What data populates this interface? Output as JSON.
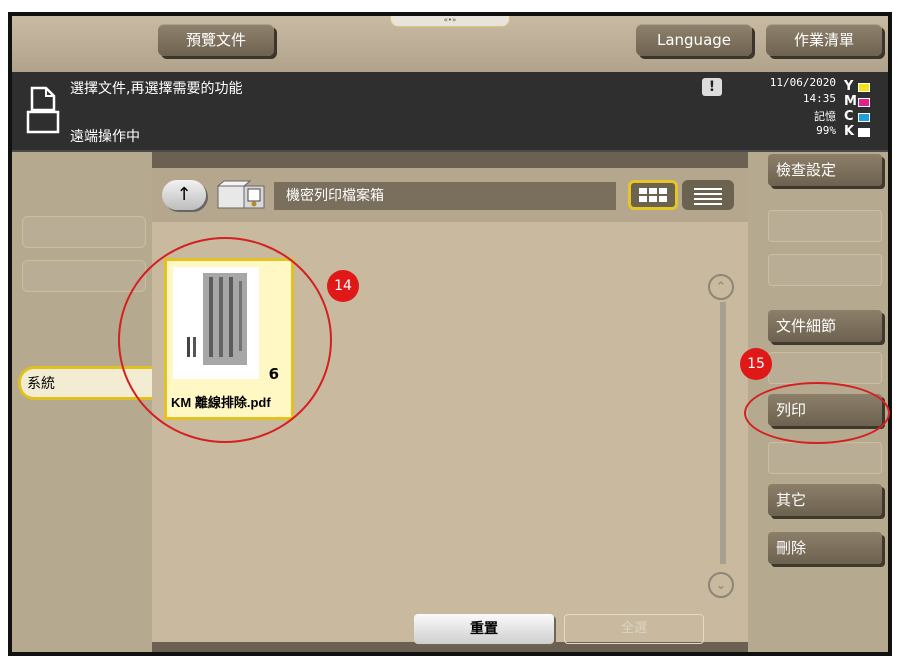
{
  "header": {
    "preview_tab": "預覽文件",
    "language_tab": "Language",
    "joblist_tab": "作業清單"
  },
  "status": {
    "message_line1": "選擇文件,再選擇需要的功能",
    "message_line2": "遠端操作中",
    "warning_symbol": "!",
    "date": "11/06/2020",
    "time": "14:35",
    "memory_label": "記憶",
    "memory_value": "99%",
    "ink": [
      "Y",
      "M",
      "C",
      "K"
    ],
    "ink_colors": [
      "#f2e21a",
      "#e0208c",
      "#1ea0e0",
      "#ffffff"
    ]
  },
  "left_panel": {
    "system_label": "系統"
  },
  "main": {
    "up_icon": "↑",
    "box_name": "機密列印檔案箱",
    "file": {
      "page_count": "6",
      "name": "KM 離線排除.pdf"
    },
    "scroll_up": "⌃",
    "scroll_down": "⌄",
    "reset_label": "重置",
    "select_all_label": "全選"
  },
  "right_panel": {
    "check_settings": "檢查設定",
    "doc_details": "文件細節",
    "print": "列印",
    "other": "其它",
    "delete": "刪除"
  },
  "annotations": {
    "marker_14": "14",
    "marker_15": "15"
  }
}
